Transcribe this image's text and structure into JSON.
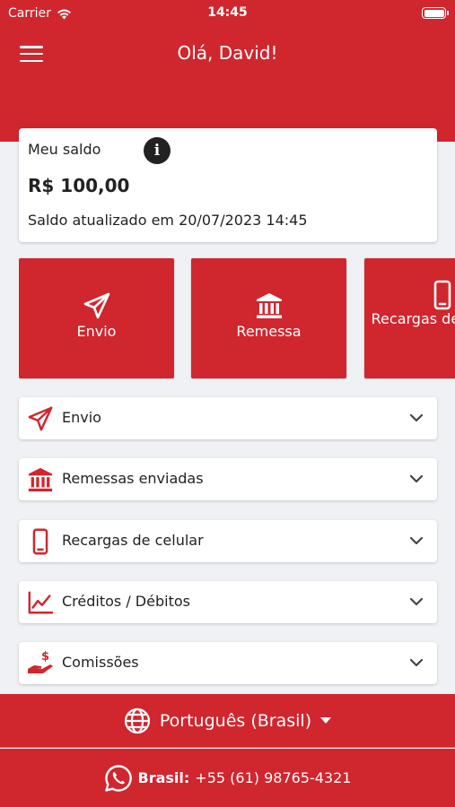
{
  "status_bar": {
    "carrier": "Carrier",
    "time": "14:45"
  },
  "header": {
    "greeting": "Olá, David!"
  },
  "balance": {
    "label": "Meu saldo",
    "value": "R$ 100,00",
    "updated": "Saldo atualizado em 20/07/2023 14:45"
  },
  "quick_actions": [
    {
      "label": "Envio",
      "icon": "paper-plane-icon"
    },
    {
      "label": "Remessa",
      "icon": "bank-icon"
    },
    {
      "label": "Recargas de celular",
      "icon": "mobile-phone-icon"
    }
  ],
  "menu_items": [
    {
      "label": "Envio",
      "icon": "paper-plane-icon"
    },
    {
      "label": "Remessas enviadas",
      "icon": "bank-icon"
    },
    {
      "label": "Recargas de celular",
      "icon": "mobile-phone-icon"
    },
    {
      "label": "Créditos / Débitos",
      "icon": "line-chart-icon"
    },
    {
      "label": "Comissões",
      "icon": "hand-money-icon"
    }
  ],
  "footer": {
    "language": "Português (Brasil)",
    "contact_label": "Brasil:",
    "contact_phone": "+55 (61) 98765-4321"
  },
  "colors": {
    "brand": "#d0262e",
    "background": "#eff1f4",
    "card": "#ffffff",
    "text": "#222222"
  }
}
